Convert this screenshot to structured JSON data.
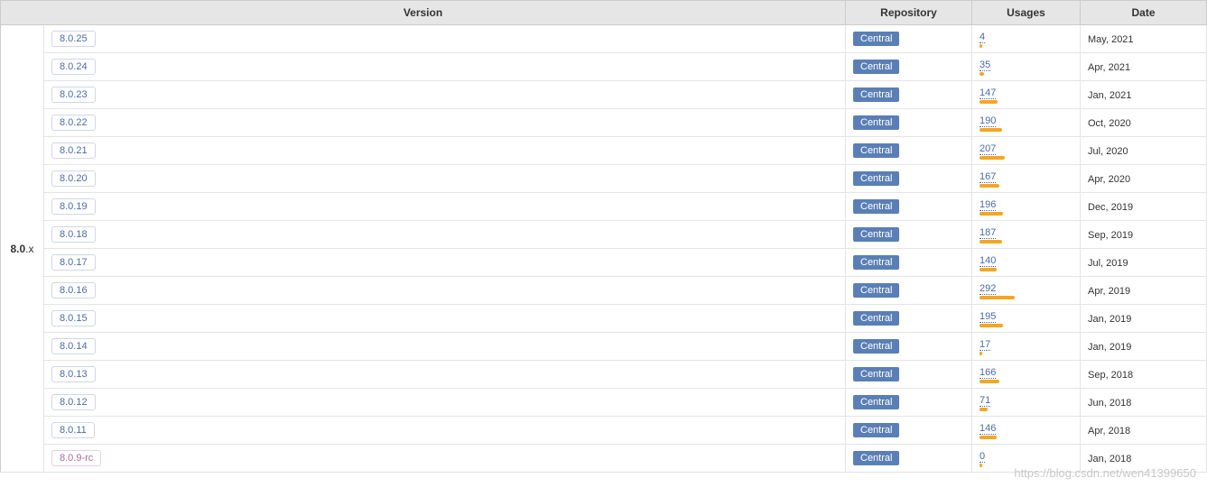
{
  "headers": {
    "version": "Version",
    "repository": "Repository",
    "usages": "Usages",
    "date": "Date"
  },
  "group": {
    "prefix": "8.0",
    "suffix": ".x"
  },
  "maxUsage": 300,
  "rows": [
    {
      "version": "8.0.25",
      "repo": "Central",
      "usages": 4,
      "date": "May, 2021",
      "rc": false
    },
    {
      "version": "8.0.24",
      "repo": "Central",
      "usages": 35,
      "date": "Apr, 2021",
      "rc": false
    },
    {
      "version": "8.0.23",
      "repo": "Central",
      "usages": 147,
      "date": "Jan, 2021",
      "rc": false
    },
    {
      "version": "8.0.22",
      "repo": "Central",
      "usages": 190,
      "date": "Oct, 2020",
      "rc": false
    },
    {
      "version": "8.0.21",
      "repo": "Central",
      "usages": 207,
      "date": "Jul, 2020",
      "rc": false
    },
    {
      "version": "8.0.20",
      "repo": "Central",
      "usages": 167,
      "date": "Apr, 2020",
      "rc": false
    },
    {
      "version": "8.0.19",
      "repo": "Central",
      "usages": 196,
      "date": "Dec, 2019",
      "rc": false
    },
    {
      "version": "8.0.18",
      "repo": "Central",
      "usages": 187,
      "date": "Sep, 2019",
      "rc": false
    },
    {
      "version": "8.0.17",
      "repo": "Central",
      "usages": 140,
      "date": "Jul, 2019",
      "rc": false
    },
    {
      "version": "8.0.16",
      "repo": "Central",
      "usages": 292,
      "date": "Apr, 2019",
      "rc": false
    },
    {
      "version": "8.0.15",
      "repo": "Central",
      "usages": 195,
      "date": "Jan, 2019",
      "rc": false
    },
    {
      "version": "8.0.14",
      "repo": "Central",
      "usages": 17,
      "date": "Jan, 2019",
      "rc": false
    },
    {
      "version": "8.0.13",
      "repo": "Central",
      "usages": 166,
      "date": "Sep, 2018",
      "rc": false
    },
    {
      "version": "8.0.12",
      "repo": "Central",
      "usages": 71,
      "date": "Jun, 2018",
      "rc": false
    },
    {
      "version": "8.0.11",
      "repo": "Central",
      "usages": 146,
      "date": "Apr, 2018",
      "rc": false
    },
    {
      "version": "8.0.9-rc",
      "repo": "Central",
      "usages": 0,
      "date": "Jan, 2018",
      "rc": true
    }
  ],
  "watermark": "https://blog.csdn.net/wen41399650"
}
